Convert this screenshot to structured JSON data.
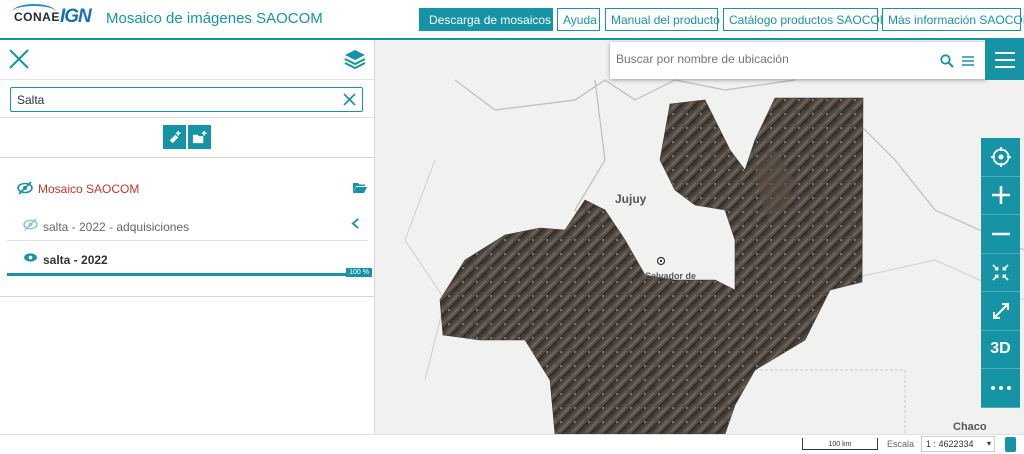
{
  "header": {
    "logo_conae": "CONAE",
    "logo_ign": "IGN",
    "title": "Mosaico de imágenes SAOCOM",
    "buttons": {
      "download": "Descarga de mosaicos",
      "help": "Ayuda",
      "manual": "Manual del producto",
      "catalog": "Catálogo productos SAOCOM",
      "more_info": "Más información SAOCOM"
    }
  },
  "panel": {
    "search_value": "Salta",
    "folder": {
      "label": "Mosaico SAOCOM"
    },
    "sublayer": {
      "label": "salta - 2022 - adquisiciones"
    },
    "layer": {
      "label": "salta - 2022",
      "progress": 100,
      "progress_label": "100 %"
    }
  },
  "map": {
    "search_placeholder": "Buscar por nombre de ubicación",
    "labels": {
      "jujuy": "Jujuy",
      "salvador": "Salvador de",
      "chaco": "Chaco"
    },
    "controls": {
      "threed": "3D"
    }
  },
  "footer": {
    "scale_bar": "100 km",
    "scale_label": "Escala",
    "scale_value": "1 : 4622334"
  },
  "colors": {
    "accent": "#1793a6",
    "folder_text": "#c0392b"
  }
}
